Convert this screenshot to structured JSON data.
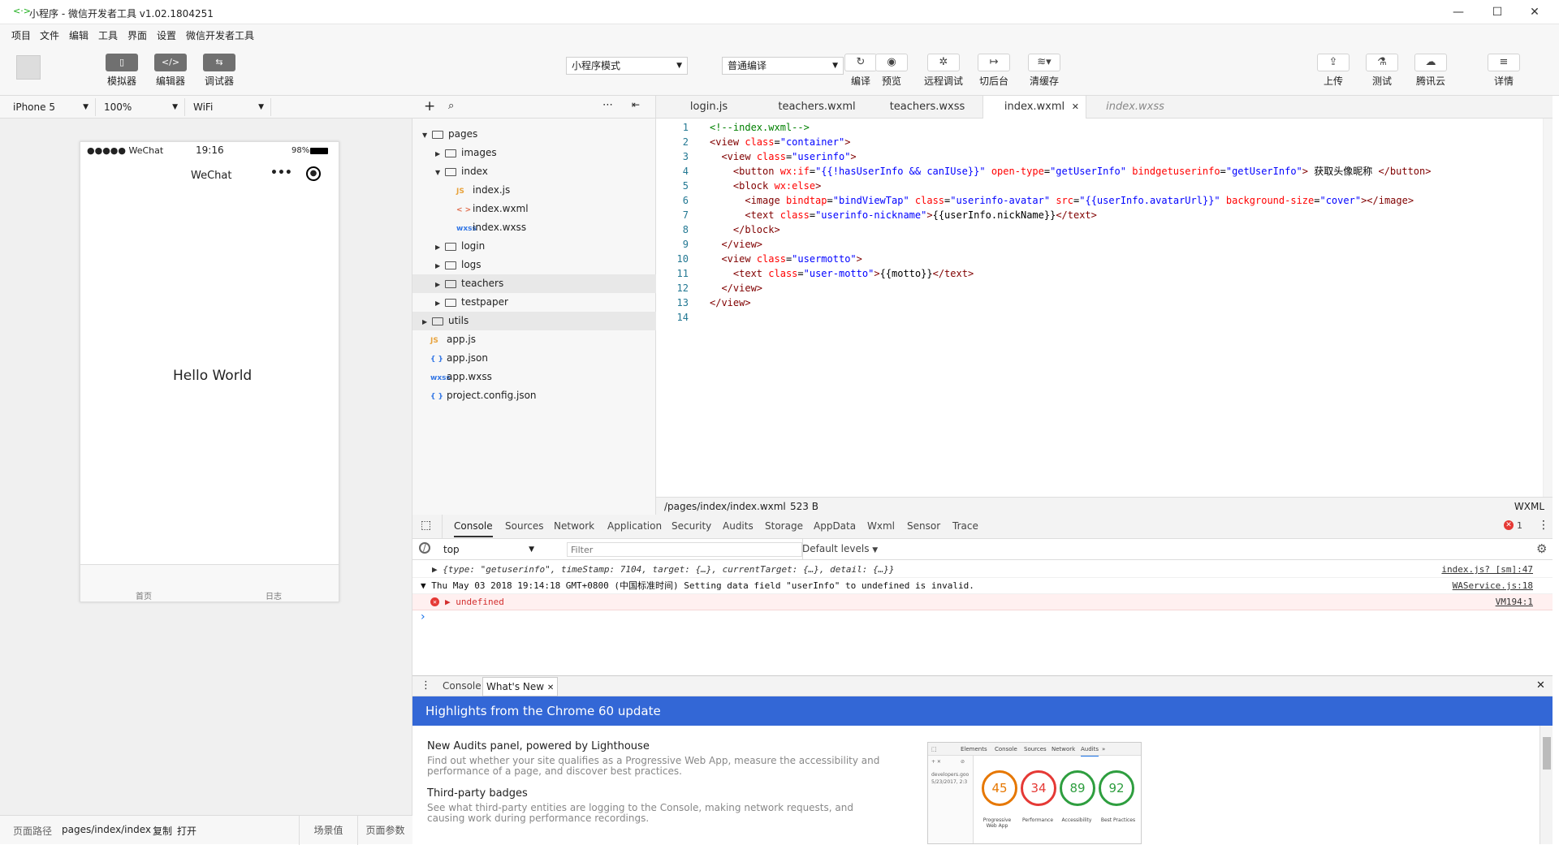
{
  "window": {
    "title": "小程序 - 微信开发者工具 v1.02.1804251",
    "logo": "<·>",
    "min": "—",
    "max": "☐",
    "close": "✕"
  },
  "menu": [
    "项目",
    "文件",
    "编辑",
    "工具",
    "界面",
    "设置",
    "微信开发者工具"
  ],
  "toolbar": {
    "simulator": "模拟器",
    "editor": "编辑器",
    "debugger": "调试器",
    "mode": "小程序模式",
    "compile_mode": "普通编译",
    "compile": "编译",
    "preview": "预览",
    "remote_debug": "远程调试",
    "background": "切后台",
    "clear_cache": "清缓存",
    "upload": "上传",
    "test": "测试",
    "tencent_cloud": "腾讯云",
    "details": "详情"
  },
  "device_bar": {
    "device": "iPhone 5",
    "zoom": "100%",
    "network": "WiFi"
  },
  "phone": {
    "carrier": "●●●●● WeChat",
    "time": "19:16",
    "battery": "98%",
    "nav_title": "WeChat",
    "content": "Hello World",
    "tabs": [
      "首页",
      "日志"
    ]
  },
  "bottom_bar": {
    "path_label": "页面路径",
    "path": "pages/index/index",
    "copy": "复制",
    "open": "打开",
    "scene": "场景值",
    "params": "页面参数"
  },
  "file_tree": [
    {
      "name": "pages",
      "type": "folder",
      "open": true,
      "depth": 0
    },
    {
      "name": "images",
      "type": "folder",
      "open": false,
      "depth": 1
    },
    {
      "name": "index",
      "type": "folder",
      "open": true,
      "depth": 1
    },
    {
      "name": "index.js",
      "type": "js",
      "depth": 2
    },
    {
      "name": "index.wxml",
      "type": "wxml",
      "depth": 2
    },
    {
      "name": "index.wxss",
      "type": "wxss",
      "depth": 2
    },
    {
      "name": "login",
      "type": "folder",
      "open": false,
      "depth": 1
    },
    {
      "name": "logs",
      "type": "folder",
      "open": false,
      "depth": 1
    },
    {
      "name": "teachers",
      "type": "folder",
      "open": false,
      "depth": 1,
      "selected": true
    },
    {
      "name": "testpaper",
      "type": "folder",
      "open": false,
      "depth": 1
    },
    {
      "name": "utils",
      "type": "folder",
      "open": false,
      "depth": 0,
      "selected": true
    },
    {
      "name": "app.js",
      "type": "js",
      "depth": 0
    },
    {
      "name": "app.json",
      "type": "json",
      "depth": 0
    },
    {
      "name": "app.wxss",
      "type": "wxss",
      "depth": 0
    },
    {
      "name": "project.config.json",
      "type": "json",
      "depth": 0
    }
  ],
  "file_icons": {
    "js": "JS",
    "wxml": "< >",
    "wxss": "wxss",
    "json": "{ }"
  },
  "editor_tabs": [
    {
      "label": "login.js",
      "active": false
    },
    {
      "label": "teachers.wxml",
      "active": false
    },
    {
      "label": "teachers.wxss",
      "active": false
    },
    {
      "label": "index.wxml",
      "active": true
    },
    {
      "label": "index.wxss",
      "active": false,
      "italic": true
    }
  ],
  "code_lines": [
    [
      [
        "cm",
        "<!--index.wxml-->"
      ]
    ],
    [
      [
        "tg",
        "<view "
      ],
      [
        "at",
        "class"
      ],
      [
        "tx",
        "="
      ],
      [
        "av",
        "\"container\""
      ],
      [
        "tg",
        ">"
      ]
    ],
    [
      [
        "tx",
        "  "
      ],
      [
        "tg",
        "<view "
      ],
      [
        "at",
        "class"
      ],
      [
        "tx",
        "="
      ],
      [
        "av",
        "\"userinfo\""
      ],
      [
        "tg",
        ">"
      ]
    ],
    [
      [
        "tx",
        "    "
      ],
      [
        "tg",
        "<button "
      ],
      [
        "at",
        "wx:if"
      ],
      [
        "tx",
        "="
      ],
      [
        "av",
        "\"{{!hasUserInfo && canIUse}}\""
      ],
      [
        "tx",
        " "
      ],
      [
        "at",
        "open-type"
      ],
      [
        "tx",
        "="
      ],
      [
        "av",
        "\"getUserInfo\""
      ],
      [
        "tx",
        " "
      ],
      [
        "at",
        "bindgetuserinfo"
      ],
      [
        "tx",
        "="
      ],
      [
        "av",
        "\"getUserInfo\""
      ],
      [
        "tg",
        ">"
      ],
      [
        "tx",
        " 获取头像昵称 "
      ],
      [
        "tg",
        "</button>"
      ]
    ],
    [
      [
        "tx",
        "    "
      ],
      [
        "tg",
        "<block "
      ],
      [
        "at",
        "wx:else"
      ],
      [
        "tg",
        ">"
      ]
    ],
    [
      [
        "tx",
        "      "
      ],
      [
        "tg",
        "<image "
      ],
      [
        "at",
        "bindtap"
      ],
      [
        "tx",
        "="
      ],
      [
        "av",
        "\"bindViewTap\""
      ],
      [
        "tx",
        " "
      ],
      [
        "at",
        "class"
      ],
      [
        "tx",
        "="
      ],
      [
        "av",
        "\"userinfo-avatar\""
      ],
      [
        "tx",
        " "
      ],
      [
        "at",
        "src"
      ],
      [
        "tx",
        "="
      ],
      [
        "av",
        "\"{{userInfo.avatarUrl}}\""
      ],
      [
        "tx",
        " "
      ],
      [
        "at",
        "background-size"
      ],
      [
        "tx",
        "="
      ],
      [
        "av",
        "\"cover\""
      ],
      [
        "tg",
        "></image>"
      ]
    ],
    [
      [
        "tx",
        "      "
      ],
      [
        "tg",
        "<text "
      ],
      [
        "at",
        "class"
      ],
      [
        "tx",
        "="
      ],
      [
        "av",
        "\"userinfo-nickname\""
      ],
      [
        "tg",
        ">"
      ],
      [
        "tx",
        "{{userInfo.nickName}}"
      ],
      [
        "tg",
        "</text>"
      ]
    ],
    [
      [
        "tx",
        "    "
      ],
      [
        "tg",
        "</block>"
      ]
    ],
    [
      [
        "tx",
        "  "
      ],
      [
        "tg",
        "</view>"
      ]
    ],
    [
      [
        "tx",
        "  "
      ],
      [
        "tg",
        "<view "
      ],
      [
        "at",
        "class"
      ],
      [
        "tx",
        "="
      ],
      [
        "av",
        "\"usermotto\""
      ],
      [
        "tg",
        ">"
      ]
    ],
    [
      [
        "tx",
        "    "
      ],
      [
        "tg",
        "<text "
      ],
      [
        "at",
        "class"
      ],
      [
        "tx",
        "="
      ],
      [
        "av",
        "\"user-motto\""
      ],
      [
        "tg",
        ">"
      ],
      [
        "tx",
        "{{motto}}"
      ],
      [
        "tg",
        "</text>"
      ]
    ],
    [
      [
        "tx",
        "  "
      ],
      [
        "tg",
        "</view>"
      ]
    ],
    [
      [
        "tg",
        "</view>"
      ]
    ],
    []
  ],
  "status": {
    "path": "/pages/index/index.wxml",
    "size": "523 B",
    "lang": "WXML"
  },
  "devtools": {
    "tabs": [
      "Console",
      "Sources",
      "Network",
      "Application",
      "Security",
      "Audits",
      "Storage",
      "AppData",
      "Wxml",
      "Sensor",
      "Trace"
    ],
    "error_count": "1",
    "context": "top",
    "filter_placeholder": "Filter",
    "levels": "Default levels"
  },
  "console_lines": [
    {
      "text": "▶ {type: \"getuserinfo\", timeStamp: 7104, target: {…}, currentTarget: {…}, detail: {…}}",
      "src": "index.js? [sm]:47",
      "kind": "log"
    },
    {
      "text": "▼ Thu May 03 2018 19:14:18 GMT+0800 (中国标准时间) Setting data field \"userInfo\" to undefined is invalid.",
      "src": "WAService.js:18",
      "kind": "group"
    },
    {
      "text": "▶ undefined",
      "src": "VM194:1",
      "kind": "error"
    }
  ],
  "console_prompt": "›",
  "drawer": {
    "tabs": [
      "Console",
      "What's New"
    ],
    "banner": "Highlights from the Chrome 60 update"
  },
  "whats_new": [
    {
      "title": "New Audits panel, powered by Lighthouse",
      "desc": "Find out whether your site qualifies as a Progressive Web App, measure the accessibility and performance of a page, and discover best practices."
    },
    {
      "title": "Third-party badges",
      "desc": "See what third-party entities are logging to the Console, making network requests, and causing work during performance recordings."
    }
  ],
  "audit_preview": {
    "tabs": [
      "Elements",
      "Console",
      "Sources",
      "Network",
      "Audits",
      "»"
    ],
    "site": "developers.goo",
    "date": "5/23/2017, 2:3",
    "scores": [
      {
        "value": "45",
        "label": "Progressive Web App",
        "color": "#e67700"
      },
      {
        "value": "34",
        "label": "Performance",
        "color": "#e53935"
      },
      {
        "value": "89",
        "label": "Accessibility",
        "color": "#2e9e3f"
      },
      {
        "value": "92",
        "label": "Best Practices",
        "color": "#2e9e3f"
      }
    ]
  }
}
